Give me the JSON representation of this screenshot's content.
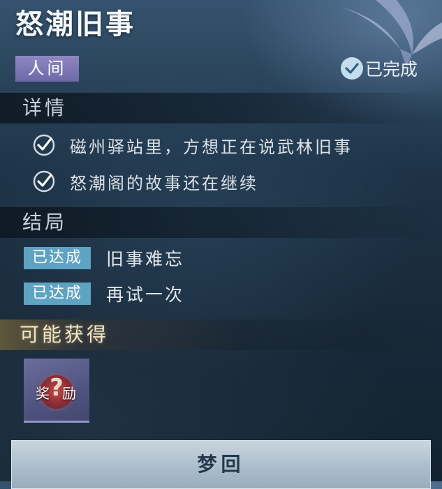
{
  "quest": {
    "title": "怒潮旧事",
    "realm_tag": "人间",
    "status_label": "已完成",
    "status_icon": "check-circle-icon"
  },
  "details": {
    "heading": "详情",
    "items": [
      {
        "text": "磁州驿站里，方想正在说武林旧事",
        "done": true
      },
      {
        "text": "怒潮阁的故事还在继续",
        "done": true
      }
    ]
  },
  "endings": {
    "heading": "结局",
    "items": [
      {
        "badge": "已达成",
        "text": "旧事难忘"
      },
      {
        "badge": "已达成",
        "text": "再试一次"
      }
    ]
  },
  "rewards": {
    "heading": "可能获得",
    "items": [
      {
        "label": "奖励",
        "icon": "question-mark-icon"
      }
    ]
  },
  "action": {
    "button_label": "梦回"
  },
  "colors": {
    "realm_tag": "#7d76b6",
    "achieved_badge": "#5fa3c3",
    "button": "#b3c4d2"
  }
}
